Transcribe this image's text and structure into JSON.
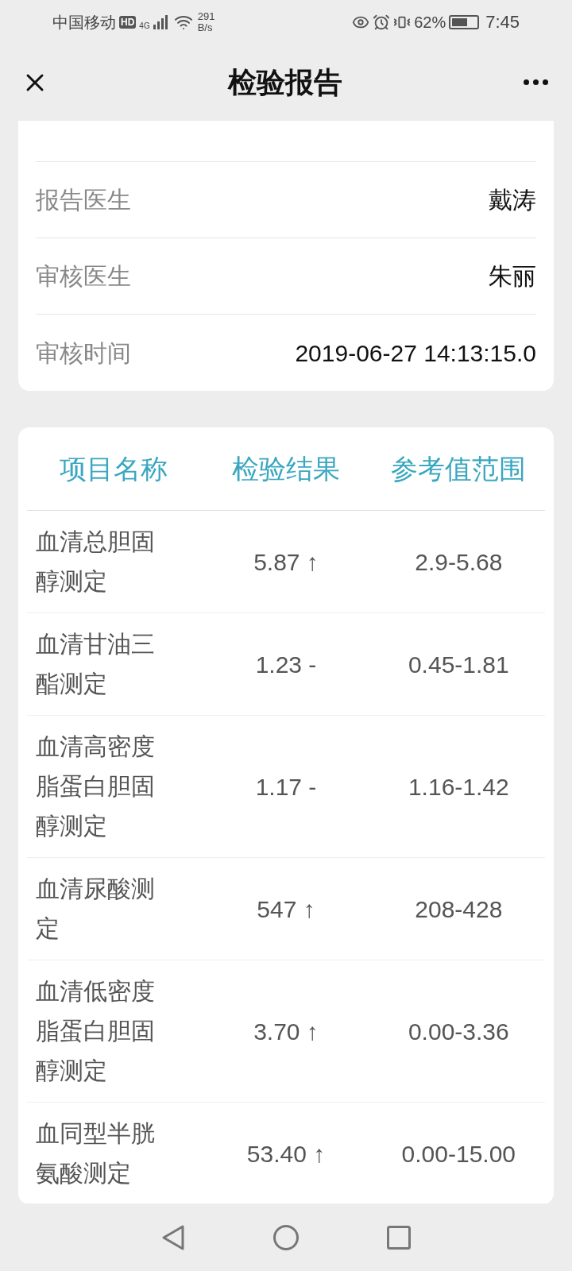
{
  "status_bar": {
    "carrier": "中国移动",
    "hd": "HD",
    "network": "4G",
    "speed_value": "291",
    "speed_unit": "B/s",
    "battery_percent": "62%",
    "time": "7:45"
  },
  "header": {
    "title": "检验报告"
  },
  "info_rows": [
    {
      "label": "报告医生",
      "value": "戴涛"
    },
    {
      "label": "审核医生",
      "value": "朱丽"
    },
    {
      "label": "审核时间",
      "value": "2019-06-27 14:13:15.0"
    }
  ],
  "results_table": {
    "columns": [
      "项目名称",
      "检验结果",
      "参考值范围"
    ],
    "rows": [
      {
        "name": "血清总胆固醇测定",
        "result": "5.87 ↑",
        "range": "2.9-5.68"
      },
      {
        "name": "血清甘油三酯测定",
        "result": "1.23 -",
        "range": "0.45-1.81"
      },
      {
        "name": "血清高密度脂蛋白胆固醇测定",
        "result": "1.17 -",
        "range": "1.16-1.42"
      },
      {
        "name": "血清尿酸测定",
        "result": "547 ↑",
        "range": "208-428"
      },
      {
        "name": "血清低密度脂蛋白胆固醇测定",
        "result": "3.70 ↑",
        "range": "0.00-3.36"
      },
      {
        "name": "血同型半胱氨酸测定",
        "result": "53.40 ↑",
        "range": "0.00-15.00"
      }
    ]
  }
}
